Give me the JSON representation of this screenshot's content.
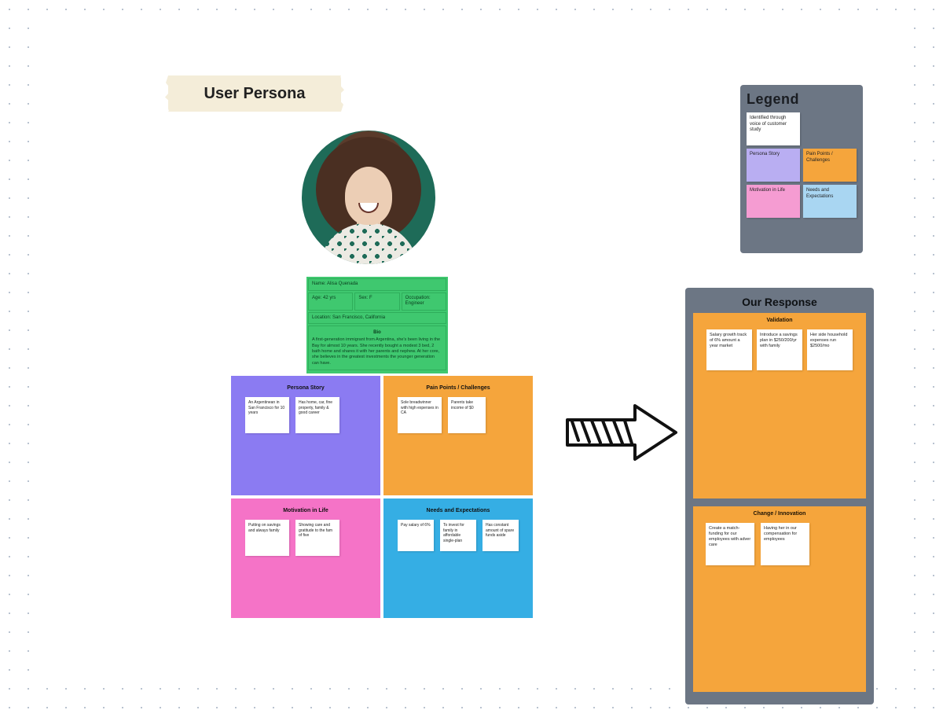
{
  "banner_title": "User Persona",
  "persona": {
    "name_label": "Name: Alisa Quenada",
    "age_label": "Age: 42 yrs",
    "sex_label": "Sex: F",
    "role_label": "Occupation: Engineer",
    "location_label": "Location: San Francisco, California",
    "bio_heading": "Bio",
    "bio_text": "A first-generation immigrant from Argentina, she's been living in the Bay for almost 10 years. She recently bought a modest 3 bed, 2 bath home and shares it with her parents and nephew. At her core, she believes in the greatest investments the younger generation can have."
  },
  "quadrants": {
    "persona_story": {
      "title": "Persona Story",
      "notes": [
        "An Argentinean in San Francisco for 10 years",
        "Has home, car, fine property, family & good career"
      ]
    },
    "pain_points": {
      "title": "Pain Points / Challenges",
      "notes": [
        "Sole breadwinner with high expenses in CA",
        "Parents take income of $0"
      ]
    },
    "motivation": {
      "title": "Motivation in Life",
      "notes": [
        "Putting on savings and always family",
        "Showing care and gratitude to the fam of five"
      ]
    },
    "needs": {
      "title": "Needs and Expectations",
      "notes": [
        "Pay salary of 6%",
        "To invest for family in affordable single-plan",
        "Has constant amount of spare funds aside"
      ]
    }
  },
  "legend": {
    "title": "Legend",
    "items": {
      "white": "Identified through voice of customer study",
      "purple": "Persona Story",
      "orange": "Pain Points / Challenges",
      "pink": "Motivation in Life",
      "blue": "Needs and Expectations"
    }
  },
  "response": {
    "title": "Our Response",
    "validation": {
      "title": "Validation",
      "notes": [
        "Salary growth track of 6% amount a year market",
        "Introduce a savings plan in $250/200/yr with family",
        "Her side household expenses run $2500/mo"
      ]
    },
    "innovation": {
      "title": "Change / Innovation",
      "notes": [
        "Create a match-funding for our employees with adver care",
        "Having her in our compensation for employees"
      ]
    }
  }
}
